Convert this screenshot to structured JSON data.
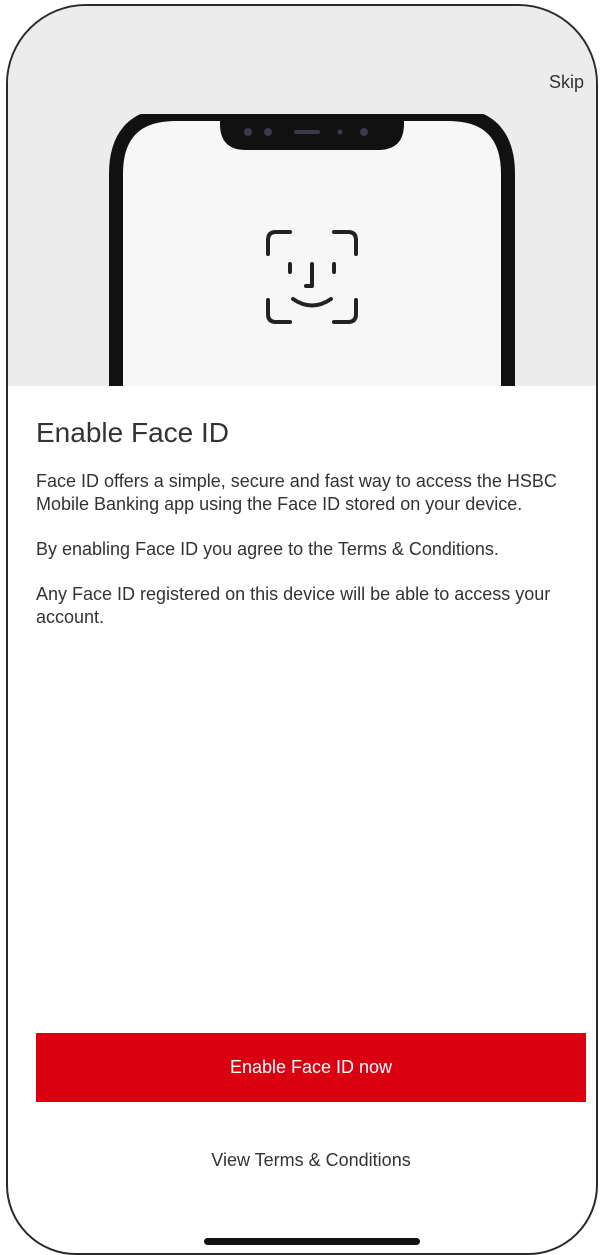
{
  "header": {
    "skip_label": "Skip"
  },
  "illustration": {
    "icon": "face-id-icon"
  },
  "main": {
    "title": "Enable Face ID",
    "paragraphs": [
      "Face ID offers a simple, secure and fast way to access the HSBC Mobile Banking app using the Face ID stored on your device.",
      "By enabling Face ID you agree to the Terms & Conditions.",
      "Any Face ID registered on this device will be able to access your account."
    ]
  },
  "actions": {
    "primary_label": "Enable Face ID now",
    "terms_label": "View Terms & Conditions"
  },
  "colors": {
    "brand_red": "#db0011",
    "hero_bg": "#ececec",
    "text": "#333333"
  }
}
